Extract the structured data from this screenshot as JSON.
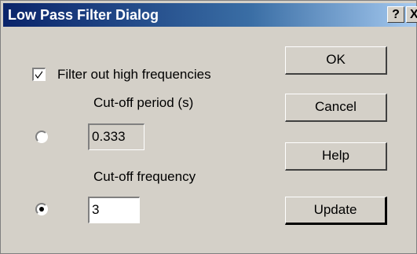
{
  "window": {
    "title": "Low Pass Filter Dialog",
    "help_glyph": "?",
    "close_glyph": "X"
  },
  "filter": {
    "checkbox_label": "Filter out high frequencies",
    "checked": true
  },
  "period": {
    "label": "Cut-off period (s)",
    "value": "0.333",
    "selected": false
  },
  "frequency": {
    "label": "Cut-off frequency",
    "value": "3",
    "selected": true
  },
  "buttons": {
    "ok": "OK",
    "cancel": "Cancel",
    "help": "Help",
    "update": "Update"
  }
}
